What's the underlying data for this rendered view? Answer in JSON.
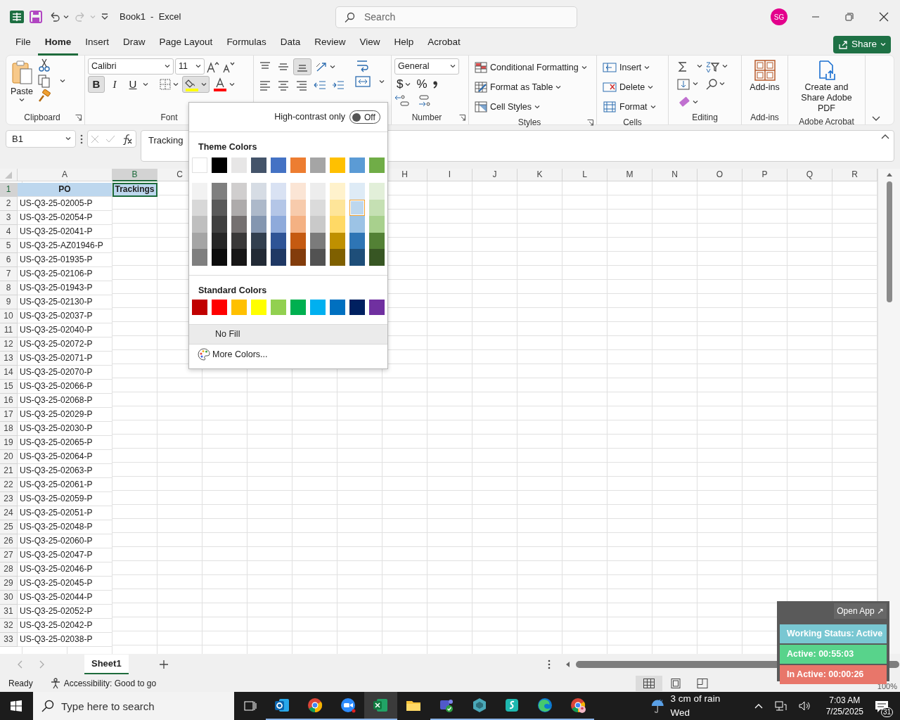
{
  "title_bar": {
    "title": "Book1  -  Excel",
    "search_placeholder": "Search",
    "avatar": "SG"
  },
  "menu_tabs": [
    {
      "label": "File",
      "selected": false
    },
    {
      "label": "Home",
      "selected": true
    },
    {
      "label": "Insert",
      "selected": false
    },
    {
      "label": "Draw",
      "selected": false
    },
    {
      "label": "Page Layout",
      "selected": false
    },
    {
      "label": "Formulas",
      "selected": false
    },
    {
      "label": "Data",
      "selected": false
    },
    {
      "label": "Review",
      "selected": false
    },
    {
      "label": "View",
      "selected": false
    },
    {
      "label": "Help",
      "selected": false
    },
    {
      "label": "Acrobat",
      "selected": false
    }
  ],
  "share_button": "Share",
  "ribbon": {
    "clipboard": {
      "paste": "Paste",
      "label": "Clipboard"
    },
    "font": {
      "name": "Calibri",
      "size": "11",
      "bold": {
        "label": "B",
        "pressed": true
      },
      "italic": {
        "label": "I",
        "pressed": false
      },
      "underline": {
        "label": "U",
        "pressed": false
      },
      "fill": {
        "color": "#ffff00",
        "open": true
      },
      "font_color": {
        "color": "#ff0000"
      },
      "label": "Font"
    },
    "alignment": {
      "bottom_align_pressed": true
    },
    "number": {
      "format": "General",
      "currency": "$",
      "percent": "%",
      "label": "Number"
    },
    "styles": {
      "items": [
        "Conditional Formatting",
        "Format as Table",
        "Cell Styles"
      ],
      "label": "Styles"
    },
    "cells": {
      "items": [
        "Insert",
        "Delete",
        "Format"
      ],
      "label": "Cells"
    },
    "editing": {
      "label": "Editing"
    },
    "addins": {
      "button": "Add-ins",
      "label": "Add-ins"
    },
    "acrobat": {
      "button": "Create and Share Adobe PDF",
      "label": "Adobe Acrobat"
    }
  },
  "formula_bar": {
    "name_box": "B1",
    "content": "Tracking"
  },
  "sheet": {
    "columns": [
      {
        "letter": "A",
        "selected": false
      },
      {
        "letter": "B",
        "selected": true
      },
      {
        "letter": "C",
        "selected": false
      },
      {
        "letter": "H",
        "selected": false
      },
      {
        "letter": "I",
        "selected": false
      },
      {
        "letter": "J",
        "selected": false
      },
      {
        "letter": "K",
        "selected": false
      },
      {
        "letter": "L",
        "selected": false
      },
      {
        "letter": "M",
        "selected": false
      },
      {
        "letter": "N",
        "selected": false
      },
      {
        "letter": "O",
        "selected": false
      },
      {
        "letter": "P",
        "selected": false
      },
      {
        "letter": "Q",
        "selected": false
      },
      {
        "letter": "R",
        "selected": false
      }
    ],
    "rows": [
      {
        "number": "1",
        "cells": [
          "PO",
          "Trackings"
        ],
        "header": true,
        "selected": true
      },
      {
        "number": "2",
        "cells": [
          "US-Q3-25-02005-P"
        ],
        "header": false,
        "selected": false
      },
      {
        "number": "3",
        "cells": [
          "US-Q3-25-02054-P"
        ],
        "header": false,
        "selected": false
      },
      {
        "number": "4",
        "cells": [
          "US-Q3-25-02041-P"
        ],
        "header": false,
        "selected": false
      },
      {
        "number": "5",
        "cells": [
          "US-Q3-25-AZ01946-P"
        ],
        "header": false,
        "selected": false
      },
      {
        "number": "6",
        "cells": [
          "US-Q3-25-01935-P"
        ],
        "header": false,
        "selected": false
      },
      {
        "number": "7",
        "cells": [
          "US-Q3-25-02106-P"
        ],
        "header": false,
        "selected": false
      },
      {
        "number": "8",
        "cells": [
          "US-Q3-25-01943-P"
        ],
        "header": false,
        "selected": false
      },
      {
        "number": "9",
        "cells": [
          "US-Q3-25-02130-P"
        ],
        "header": false,
        "selected": false
      },
      {
        "number": "10",
        "cells": [
          "US-Q3-25-02037-P"
        ],
        "header": false,
        "selected": false
      },
      {
        "number": "11",
        "cells": [
          "US-Q3-25-02040-P"
        ],
        "header": false,
        "selected": false
      },
      {
        "number": "12",
        "cells": [
          "US-Q3-25-02072-P"
        ],
        "header": false,
        "selected": false
      },
      {
        "number": "13",
        "cells": [
          "US-Q3-25-02071-P"
        ],
        "header": false,
        "selected": false
      },
      {
        "number": "14",
        "cells": [
          "US-Q3-25-02070-P"
        ],
        "header": false,
        "selected": false
      },
      {
        "number": "15",
        "cells": [
          "US-Q3-25-02066-P"
        ],
        "header": false,
        "selected": false
      },
      {
        "number": "16",
        "cells": [
          "US-Q3-25-02068-P"
        ],
        "header": false,
        "selected": false
      },
      {
        "number": "17",
        "cells": [
          "US-Q3-25-02029-P"
        ],
        "header": false,
        "selected": false
      },
      {
        "number": "18",
        "cells": [
          "US-Q3-25-02030-P"
        ],
        "header": false,
        "selected": false
      },
      {
        "number": "19",
        "cells": [
          "US-Q3-25-02065-P"
        ],
        "header": false,
        "selected": false
      },
      {
        "number": "20",
        "cells": [
          "US-Q3-25-02064-P"
        ],
        "header": false,
        "selected": false
      },
      {
        "number": "21",
        "cells": [
          "US-Q3-25-02063-P"
        ],
        "header": false,
        "selected": false
      },
      {
        "number": "22",
        "cells": [
          "US-Q3-25-02061-P"
        ],
        "header": false,
        "selected": false
      },
      {
        "number": "23",
        "cells": [
          "US-Q3-25-02059-P"
        ],
        "header": false,
        "selected": false
      },
      {
        "number": "24",
        "cells": [
          "US-Q3-25-02051-P"
        ],
        "header": false,
        "selected": false
      },
      {
        "number": "25",
        "cells": [
          "US-Q3-25-02048-P"
        ],
        "header": false,
        "selected": false
      },
      {
        "number": "26",
        "cells": [
          "US-Q3-25-02060-P"
        ],
        "header": false,
        "selected": false
      },
      {
        "number": "27",
        "cells": [
          "US-Q3-25-02047-P"
        ],
        "header": false,
        "selected": false
      },
      {
        "number": "28",
        "cells": [
          "US-Q3-25-02046-P"
        ],
        "header": false,
        "selected": false
      },
      {
        "number": "29",
        "cells": [
          "US-Q3-25-02045-P"
        ],
        "header": false,
        "selected": false
      },
      {
        "number": "30",
        "cells": [
          "US-Q3-25-02044-P"
        ],
        "header": false,
        "selected": false
      },
      {
        "number": "31",
        "cells": [
          "US-Q3-25-02052-P"
        ],
        "header": false,
        "selected": false
      },
      {
        "number": "32",
        "cells": [
          "US-Q3-25-02042-P"
        ],
        "header": false,
        "selected": false
      },
      {
        "number": "33",
        "cells": [
          "US-Q3-25-02038-P"
        ],
        "header": false,
        "selected": false
      }
    ]
  },
  "sheet_tabs": [
    {
      "label": "Sheet1",
      "selected": true
    }
  ],
  "status_bar": {
    "status": "Ready",
    "accessibility": "Accessibility: Good to go",
    "zoom": "100%"
  },
  "fill_menu": {
    "high_contrast": {
      "label": "High-contrast only",
      "on": false,
      "state_label": "Off"
    },
    "theme_title": "Theme Colors",
    "theme_row": [
      {
        "color": "#ffffff",
        "selected": false
      },
      {
        "color": "#000000",
        "selected": false
      },
      {
        "color": "#e7e6e6",
        "selected": false
      },
      {
        "color": "#44546a",
        "selected": false
      },
      {
        "color": "#4472c4",
        "selected": false
      },
      {
        "color": "#ed7d31",
        "selected": false
      },
      {
        "color": "#a5a5a5",
        "selected": false
      },
      {
        "color": "#ffc000",
        "selected": false
      },
      {
        "color": "#5b9bd5",
        "selected": false
      },
      {
        "color": "#70ad47",
        "selected": false
      }
    ],
    "shades": [
      [
        {
          "color": "#f2f2f2",
          "selected": false
        },
        {
          "color": "#7f7f7f",
          "selected": false
        },
        {
          "color": "#d0cece",
          "selected": false
        },
        {
          "color": "#d6dce4",
          "selected": false
        },
        {
          "color": "#d9e2f3",
          "selected": false
        },
        {
          "color": "#fbe5d5",
          "selected": false
        },
        {
          "color": "#ededed",
          "selected": false
        },
        {
          "color": "#fff2cc",
          "selected": false
        },
        {
          "color": "#deebf6",
          "selected": false
        },
        {
          "color": "#e2efd9",
          "selected": false
        }
      ],
      [
        {
          "color": "#d8d8d8",
          "selected": false
        },
        {
          "color": "#595959",
          "selected": false
        },
        {
          "color": "#aeabab",
          "selected": false
        },
        {
          "color": "#adb9ca",
          "selected": false
        },
        {
          "color": "#b4c6e7",
          "selected": false
        },
        {
          "color": "#f7cbac",
          "selected": false
        },
        {
          "color": "#dbdbdb",
          "selected": false
        },
        {
          "color": "#fee599",
          "selected": false
        },
        {
          "color": "#bdd7ee",
          "selected": true
        },
        {
          "color": "#c5e0b3",
          "selected": false
        }
      ],
      [
        {
          "color": "#bfbfbf",
          "selected": false
        },
        {
          "color": "#3f3f3f",
          "selected": false
        },
        {
          "color": "#757070",
          "selected": false
        },
        {
          "color": "#8496b0",
          "selected": false
        },
        {
          "color": "#8eaadb",
          "selected": false
        },
        {
          "color": "#f4b183",
          "selected": false
        },
        {
          "color": "#c9c9c9",
          "selected": false
        },
        {
          "color": "#ffd965",
          "selected": false
        },
        {
          "color": "#9cc3e5",
          "selected": false
        },
        {
          "color": "#a8d08d",
          "selected": false
        }
      ],
      [
        {
          "color": "#a5a5a5",
          "selected": false
        },
        {
          "color": "#262626",
          "selected": false
        },
        {
          "color": "#3a3838",
          "selected": false
        },
        {
          "color": "#323f4f",
          "selected": false
        },
        {
          "color": "#2f5496",
          "selected": false
        },
        {
          "color": "#c55a11",
          "selected": false
        },
        {
          "color": "#7b7b7b",
          "selected": false
        },
        {
          "color": "#bf9000",
          "selected": false
        },
        {
          "color": "#2e75b5",
          "selected": false
        },
        {
          "color": "#538135",
          "selected": false
        }
      ],
      [
        {
          "color": "#7f7f7f",
          "selected": false
        },
        {
          "color": "#0c0c0c",
          "selected": false
        },
        {
          "color": "#171616",
          "selected": false
        },
        {
          "color": "#222a35",
          "selected": false
        },
        {
          "color": "#1f3864",
          "selected": false
        },
        {
          "color": "#833c0b",
          "selected": false
        },
        {
          "color": "#525252",
          "selected": false
        },
        {
          "color": "#7f6000",
          "selected": false
        },
        {
          "color": "#1e4e79",
          "selected": false
        },
        {
          "color": "#375623",
          "selected": false
        }
      ]
    ],
    "standard_title": "Standard Colors",
    "standard": [
      {
        "color": "#c00000",
        "selected": false
      },
      {
        "color": "#ff0000",
        "selected": false
      },
      {
        "color": "#ffc000",
        "selected": false
      },
      {
        "color": "#ffff00",
        "selected": false
      },
      {
        "color": "#92d050",
        "selected": false
      },
      {
        "color": "#00b050",
        "selected": false
      },
      {
        "color": "#00b0f0",
        "selected": false
      },
      {
        "color": "#0070c0",
        "selected": false
      },
      {
        "color": "#002060",
        "selected": false
      },
      {
        "color": "#7030a0",
        "selected": false
      }
    ],
    "no_fill": {
      "label": "No Fill",
      "highlighted": true
    },
    "more_colors": "More Colors..."
  },
  "tracker_widget": {
    "open_app": "Open App ↗",
    "items": [
      {
        "text": "Working Status: Active",
        "color": "#79c7d2"
      },
      {
        "text": "Active: 00:55:03",
        "color": "#58d38b"
      },
      {
        "text": "In Active: 00:00:26",
        "color": "#e8766a"
      }
    ]
  },
  "taskbar": {
    "search_placeholder": "Type here to search",
    "apps": [
      {
        "kind": "outlook",
        "selected": false,
        "running": true
      },
      {
        "kind": "chrome",
        "selected": false,
        "running": true
      },
      {
        "kind": "zoom",
        "selected": false,
        "running": true
      },
      {
        "kind": "excel",
        "selected": true,
        "running": true
      },
      {
        "kind": "explorer",
        "selected": false,
        "running": false
      },
      {
        "kind": "teams",
        "selected": false,
        "running": true
      },
      {
        "kind": "gem",
        "selected": false,
        "running": true
      },
      {
        "kind": "vpn",
        "selected": false,
        "running": true
      },
      {
        "kind": "edge",
        "selected": false,
        "running": true
      },
      {
        "kind": "chrome-profile",
        "selected": false,
        "running": true
      }
    ],
    "weather": "3 cm of rain Wed",
    "time": "7:03 AM",
    "date": "7/25/2025",
    "notifications": "31"
  }
}
